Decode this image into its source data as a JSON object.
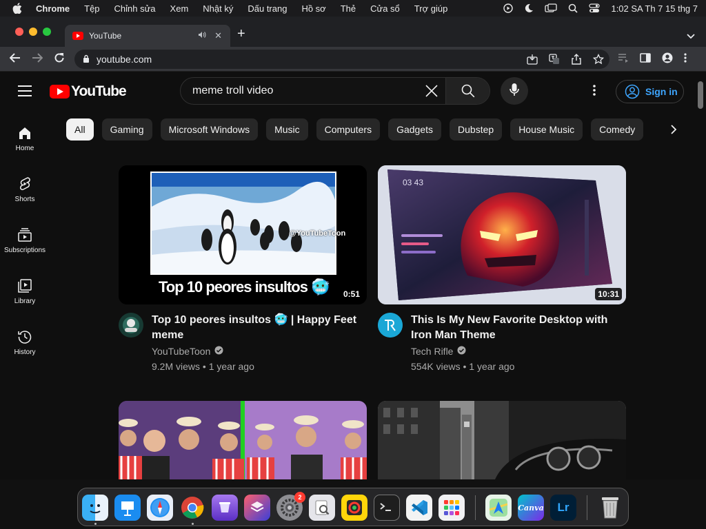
{
  "menubar": {
    "app_name": "Chrome",
    "items": [
      "Tệp",
      "Chỉnh sửa",
      "Xem",
      "Nhật ký",
      "Dấu trang",
      "Hồ sơ",
      "Thẻ",
      "Cửa sổ",
      "Trợ giúp"
    ],
    "clock": "1:02 SA Th 7 15 thg 7",
    "icons": [
      "play-circle-icon",
      "moon-icon",
      "screen-mirror-icon",
      "search-icon",
      "control-center-icon"
    ]
  },
  "browser": {
    "tab_title": "YouTube",
    "tab_audio": "speaker-icon",
    "url": "youtube.com"
  },
  "youtube": {
    "logo_text": "YouTube",
    "search_value": "meme troll video",
    "signin_label": "Sign in",
    "colors": {
      "brand": "#ff0000",
      "link": "#3ea6ff",
      "background": "#0f0f0f"
    },
    "chips": [
      "All",
      "Gaming",
      "Microsoft Windows",
      "Music",
      "Computers",
      "Gadgets",
      "Dubstep",
      "House Music",
      "Comedy"
    ],
    "active_chip": "All",
    "guide": [
      {
        "label": "Home",
        "icon": "home-icon"
      },
      {
        "label": "Shorts",
        "icon": "shorts-icon"
      },
      {
        "label": "Subscriptions",
        "icon": "subscriptions-icon"
      },
      {
        "label": "Library",
        "icon": "library-icon"
      },
      {
        "label": "History",
        "icon": "history-icon"
      }
    ],
    "videos": [
      {
        "thumb_caption": "Top 10 peores insultos 🥶",
        "thumb_watermark": "@YouTubeToon",
        "duration": "0:51",
        "title": "Top 10 peores insultos 🥶 | Happy Feet meme",
        "channel": "YouTubeToon",
        "verified": true,
        "stats": "9.2M views • 1 year ago"
      },
      {
        "thumb_clock": "03 43",
        "duration": "10:31",
        "title": "This Is My New Favorite Desktop with Iron Man Theme",
        "channel": "Tech Rifle",
        "verified": true,
        "stats": "554K views • 1 year ago"
      }
    ]
  },
  "dock": {
    "apps": [
      {
        "name": "Finder",
        "icon": "finder-icon"
      },
      {
        "name": "Keynote",
        "icon": "keynote-icon"
      },
      {
        "name": "Safari",
        "icon": "safari-icon"
      },
      {
        "name": "Chrome",
        "icon": "chrome-icon"
      },
      {
        "name": "Shortcuts storage",
        "icon": "purple-app-icon"
      },
      {
        "name": "Shortcuts",
        "icon": "shortcuts-icon"
      },
      {
        "name": "System Settings",
        "icon": "settings-icon",
        "badge": "2"
      },
      {
        "name": "Preview",
        "icon": "preview-icon"
      },
      {
        "name": "Color Picker",
        "icon": "color-picker-icon"
      },
      {
        "name": "Terminal",
        "icon": "terminal-icon"
      },
      {
        "name": "VS Code",
        "icon": "vscode-icon"
      },
      {
        "name": "Launchpad",
        "icon": "launchpad-icon"
      },
      {
        "name": "Maps",
        "icon": "maps-icon"
      },
      {
        "name": "Canva",
        "icon": "canva-icon",
        "label": "Canva"
      },
      {
        "name": "Lightroom",
        "icon": "lightroom-icon",
        "label": "Lr"
      },
      {
        "name": "Trash",
        "icon": "trash-icon"
      }
    ]
  }
}
